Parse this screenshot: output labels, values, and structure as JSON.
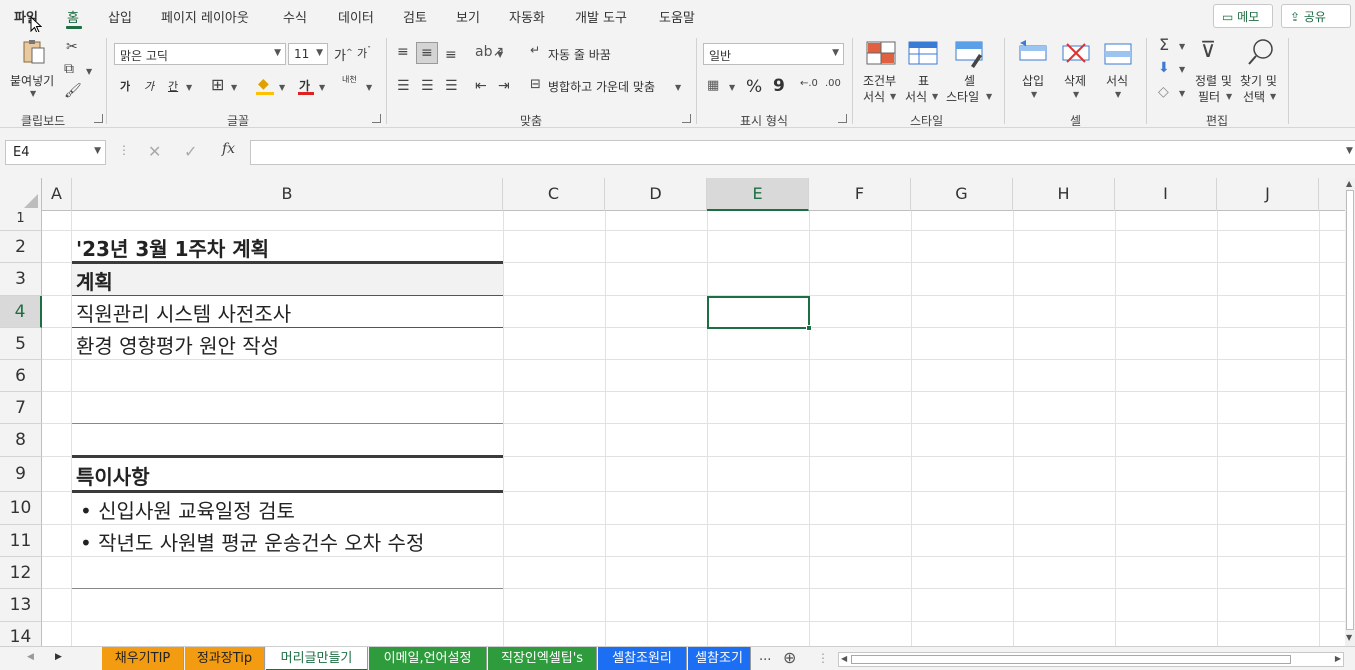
{
  "menu": {
    "items": [
      "파일",
      "홈",
      "삽입",
      "페이지 레이아웃",
      "수식",
      "데이터",
      "검토",
      "보기",
      "자동화",
      "개발 도구",
      "도움말"
    ],
    "memo": "메모",
    "share": "공유"
  },
  "ribbon": {
    "clipboard": {
      "paste": "붙여넣기",
      "label": "클립보드"
    },
    "font": {
      "name": "맑은 고딕",
      "size": "11",
      "label": "글꼴",
      "bold": "가",
      "italic": "가",
      "underline": "간",
      "grow": "가",
      "shrink": "가",
      "fontcolor": "가",
      "phonetic": "내천"
    },
    "align": {
      "wrap": "자동 줄 바꿈",
      "merge": "병합하고 가운데 맞춤",
      "label": "맞춤"
    },
    "number": {
      "format": "일반",
      "percent": "%",
      "comma": "9",
      "label": "표시 형식"
    },
    "styles": {
      "cond1": "조건부",
      "cond2": "서식",
      "table1": "표",
      "table2": "서식",
      "cell1": "셀",
      "cell2": "스타일",
      "label": "스타일"
    },
    "cells": {
      "insert": "삽입",
      "delete": "삭제",
      "format": "서식",
      "label": "셀"
    },
    "editing": {
      "sort1": "정렬 및",
      "sort2": "필터",
      "find1": "찾기 및",
      "find2": "선택",
      "label": "편집"
    }
  },
  "formula_bar": {
    "name_box": "E4",
    "fx": "fx",
    "content": ""
  },
  "grid": {
    "columns": [
      "A",
      "B",
      "C",
      "D",
      "E",
      "F",
      "G",
      "H",
      "I",
      "J"
    ],
    "selected_column": "E",
    "rows": [
      "1",
      "2",
      "3",
      "4",
      "5",
      "6",
      "7",
      "8",
      "9",
      "10",
      "11",
      "12",
      "13",
      "14"
    ],
    "selected_row": "4",
    "cells": {
      "B2": "'23년 3월 1주차 계획",
      "B3": "계획",
      "B4": "직원관리 시스템 사전조사",
      "B5": "환경 영향평가 원안 작성",
      "B9": "특이사항",
      "B10": "• 신입사원 교육일정 검토",
      "B11": "• 작년도 사원별 평균 운송건수 오차 수정"
    }
  },
  "sheets": [
    {
      "name": "채우기TIP",
      "color": "#f39c12"
    },
    {
      "name": "정과장Tip",
      "color": "#f39c12"
    },
    {
      "name": "머리글만들기",
      "color": "#ffffff"
    },
    {
      "name": "이메일,언어설정",
      "color": "#2e9c3c"
    },
    {
      "name": "직장인엑셀팁's",
      "color": "#2e9c3c"
    },
    {
      "name": "셀참조원리",
      "color": "#1c6ef2"
    },
    {
      "name": "셀참조기",
      "color": "#1c6ef2"
    }
  ],
  "active_sheet": "머리글만들기",
  "more_sheets": "...",
  "accent": "#1e6e43"
}
